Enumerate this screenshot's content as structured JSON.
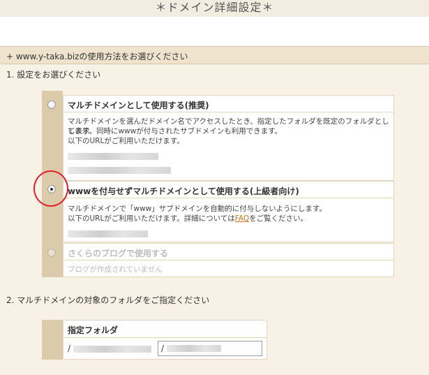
{
  "header": {
    "title": "＊ドメイン詳細設定＊"
  },
  "panel": {
    "heading": "+ www.y-taka.bizの使用方法をお選びください"
  },
  "step1": {
    "label": "1. 設定をお選びください"
  },
  "options": [
    {
      "title": "マルチドメインとして使用する(推奨)",
      "desc_line1": "マルチドメインを選んだドメイン名でアクセスしたとき、指定したフォルダを既定のフォルダとして表示",
      "desc_line2": "します。同時にwwwが付与されたサブドメインも利用できます。",
      "desc_line3": "以下のURLがご利用いただけます。",
      "selected": false
    },
    {
      "title": "wwwを付与せずマルチドメインとして使用する(上級者向け)",
      "desc_line1": "マルチドメインで「www」サブドメインを自動的に付与しないようにします。",
      "desc_line2_pre": "以下のURLがご利用いただけます。詳細については",
      "desc_link": "FAQ",
      "desc_line2_post": "をご覧ください。",
      "selected": true
    },
    {
      "title": "さくらのブログで使用する",
      "desc_line1": "ブログが作成されていません",
      "disabled": true
    }
  ],
  "step2": {
    "label": "2. マルチドメインの対象のフォルダをご指定ください"
  },
  "folder": {
    "title": "指定フォルダ",
    "root_prefix": "/",
    "input_prefix": "/"
  },
  "colors": {
    "accent_red": "#e0202a",
    "panel_bg": "#f8f2e6",
    "radio_column": "#dccbaa",
    "link": "#c8761a"
  }
}
